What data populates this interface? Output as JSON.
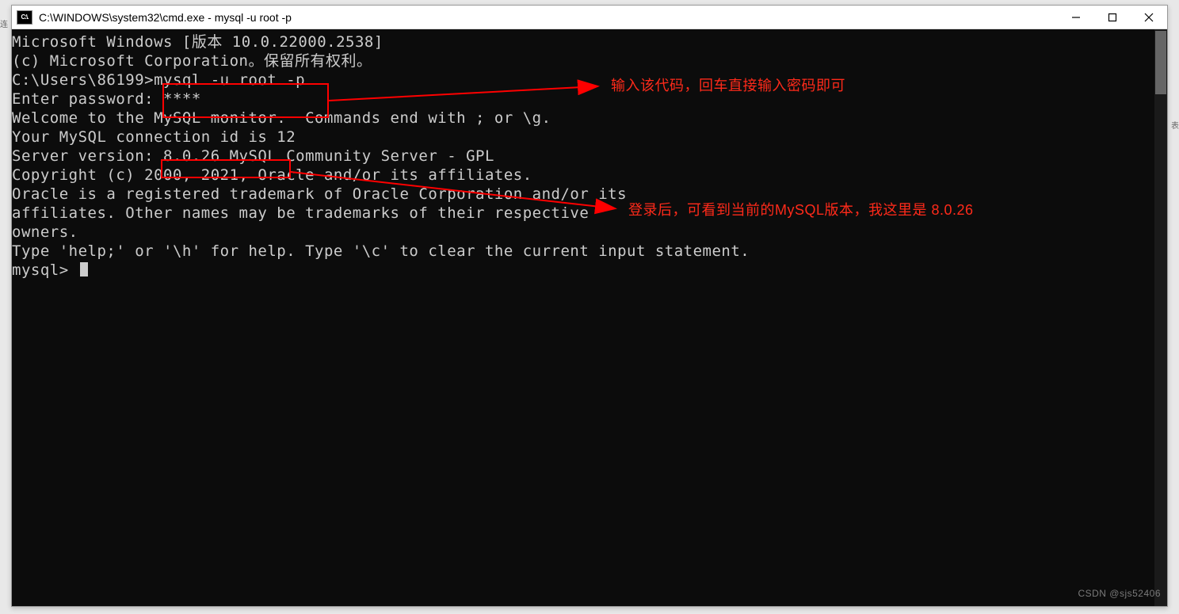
{
  "titlebar": {
    "icon_label": "C:\\.",
    "title": "C:\\WINDOWS\\system32\\cmd.exe - mysql  -u root -p"
  },
  "console": {
    "line_win_ver": "Microsoft Windows [版本 10.0.22000.2538]",
    "line_copyright_ms": "(c) Microsoft Corporation。保留所有权利。",
    "blank1": "",
    "line_prompt_cmd": "C:\\Users\\86199>mysql -u root -p",
    "line_enter_pw": "Enter password: ****",
    "line_welcome": "Welcome to the MySQL monitor.  Commands end with ; or \\g.",
    "line_conn_id": "Your MySQL connection id is 12",
    "line_server_ver": "Server version: 8.0.26 MySQL Community Server - GPL",
    "blank2": "",
    "line_copyright_oracle": "Copyright (c) 2000, 2021, Oracle and/or its affiliates.",
    "blank3": "",
    "line_trademark1": "Oracle is a registered trademark of Oracle Corporation and/or its",
    "line_trademark2": "affiliates. Other names may be trademarks of their respective",
    "line_trademark3": "owners.",
    "blank4": "",
    "line_help": "Type 'help;' or '\\h' for help. Type '\\c' to clear the current input statement.",
    "blank5": "",
    "line_mysql_prompt": "mysql> "
  },
  "annotations": {
    "note1": "输入该代码，回车直接输入密码即可",
    "note2": "登录后，可看到当前的MySQL版本，我这里是 8.0.26"
  },
  "watermark": "CSDN @sjs52406"
}
